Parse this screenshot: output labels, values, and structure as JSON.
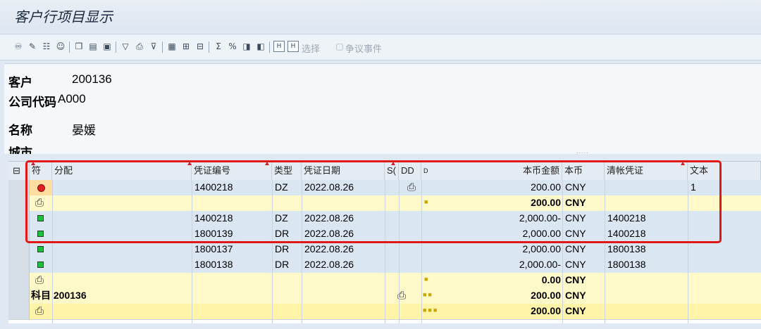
{
  "window": {
    "title": "客户行项目显示"
  },
  "toolbar": {
    "icons": [
      "glasses-icon",
      "pencil-icon",
      "grid-icon",
      "person-icon",
      "document-icon",
      "folder-icon",
      "note-icon",
      "filter-icon",
      "print-icon",
      "sort-icon",
      "layout-icon",
      "layout2-icon",
      "layout3-icon",
      "sum-icon",
      "subtotal-icon",
      "export-icon",
      "attach-icon",
      "h1-icon",
      "h2-icon"
    ],
    "select_label": "选择",
    "dispute_label": "争议事件"
  },
  "header": {
    "customer_label": "客户",
    "customer_value": "200136",
    "company_label": "公司代码",
    "company_value": "A000",
    "name_label": "名称",
    "name_value": "晏媛",
    "city_label": "城市"
  },
  "table": {
    "columns": {
      "symbol": "符",
      "assign": "分配",
      "doc_no": "凭证编号",
      "type": "类型",
      "doc_date": "凭证日期",
      "s": "S(",
      "dd": "DD",
      "d": "D",
      "amount": "本币金额",
      "currency": "本币",
      "clearing": "清帐凭证",
      "text": "文本"
    },
    "rows": [
      {
        "status": "red",
        "doc_no": "1400218",
        "type": "DZ",
        "date": "2022.08.26",
        "dd_icon": "document-icon",
        "amount": "200.00",
        "currency": "CNY",
        "clearing": "",
        "text": "1"
      },
      {
        "kind": "subtotal",
        "amount": "200.00",
        "currency": "CNY"
      },
      {
        "status": "green",
        "doc_no": "1400218",
        "type": "DZ",
        "date": "2022.08.26",
        "amount": "2,000.00-",
        "currency": "CNY",
        "clearing": "1400218"
      },
      {
        "status": "green",
        "doc_no": "1800139",
        "type": "DR",
        "date": "2022.08.26",
        "amount": "2,000.00",
        "currency": "CNY",
        "clearing": "1400218"
      },
      {
        "status": "green",
        "doc_no": "1800137",
        "type": "DR",
        "date": "2022.08.26",
        "amount": "2,000.00",
        "currency": "CNY",
        "clearing": "1800138"
      },
      {
        "status": "green",
        "doc_no": "1800138",
        "type": "DR",
        "date": "2022.08.26",
        "amount": "2,000.00-",
        "currency": "CNY",
        "clearing": "1800138"
      },
      {
        "kind": "subtotal",
        "amount": "0.00",
        "currency": "CNY"
      },
      {
        "kind": "account",
        "label": "科目 200136",
        "amount": "200.00",
        "currency": "CNY"
      },
      {
        "kind": "total",
        "amount": "200.00",
        "currency": "CNY"
      }
    ]
  },
  "colors": {
    "highlight_border": "#e01818",
    "subtotal_bg": "#fff9c9",
    "total_bg": "#fff4a8",
    "row_bg": "#dbe6f3"
  }
}
